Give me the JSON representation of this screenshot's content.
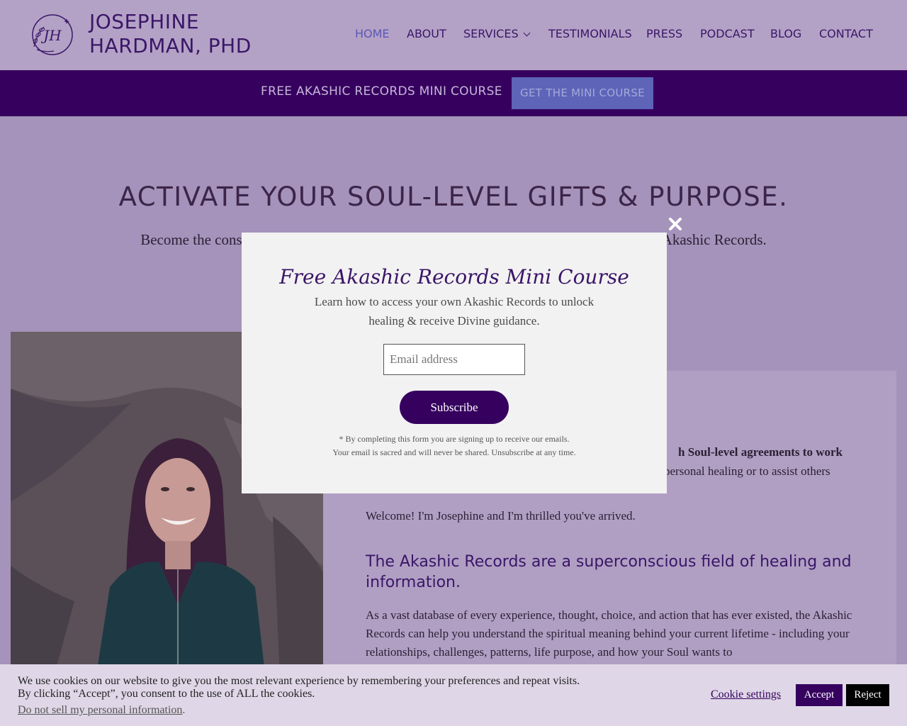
{
  "header": {
    "logo_letters": "JH",
    "site_title_line1": "JOSEPHINE",
    "site_title_line2": "HARDMAN, PHD"
  },
  "nav": {
    "items": [
      {
        "label": "HOME",
        "active": true
      },
      {
        "label": "ABOUT"
      },
      {
        "label": "SERVICES",
        "has_dropdown": true
      },
      {
        "label": "TESTIMONIALS"
      },
      {
        "label": "PRESS"
      },
      {
        "label": "PODCAST"
      },
      {
        "label": "BLOG"
      },
      {
        "label": "CONTACT"
      }
    ]
  },
  "banner": {
    "text": "FREE AKASHIC RECORDS MINI COURSE",
    "button": "GET THE MINI COURSE"
  },
  "hero": {
    "title": "ACTIVATE YOUR SOUL-LEVEL GIFTS & PURPOSE.",
    "subtitle_start": "Become the cons",
    "subtitle_end": "Akashic Records."
  },
  "content": {
    "intro_line1_bold": "h Soul-level agreements to work",
    "intro_line2": "personal healing or to assist others",
    "welcome": "Welcome! I'm Josephine and I'm thrilled you've arrived.",
    "heading": "The Akashic Records are a superconscious field of healing and information.",
    "body": "As a vast database of every experience, thought, choice, and action that has ever existed, the Akashic Records can help you understand the spiritual meaning behind your current lifetime - including your relationships, challenges, patterns, life purpose, and how your Soul wants to"
  },
  "modal": {
    "title": "Free Akashic Records Mini Course",
    "description": "Learn how to access your own Akashic Records to unlock healing & receive Divine guidance.",
    "email_placeholder": "Email address",
    "subscribe": "Subscribe",
    "fine_line1": "* By completing this form you are signing up to receive our emails.",
    "fine_line2": "Your email is sacred and will never be shared. Unsubscribe at any time."
  },
  "cookie": {
    "line1": "We use cookies on our website to give you the most relevant experience by remembering your preferences and repeat visits.",
    "line2": "By clicking “Accept”, you consent to the use of ALL the cookies.",
    "do_not_sell": "Do not sell my personal information",
    "do_not_sell_suffix": ".",
    "settings": "Cookie settings",
    "accept": "Accept",
    "reject": "Reject"
  },
  "colors": {
    "primary_purple": "#36005f",
    "accent_blue": "#5e64b8",
    "header_bg": "#b4a2c6"
  },
  "icons": {
    "close": "close-icon",
    "logo": "monogram-leaf-logo",
    "dropdown": "chevron-down-icon"
  }
}
